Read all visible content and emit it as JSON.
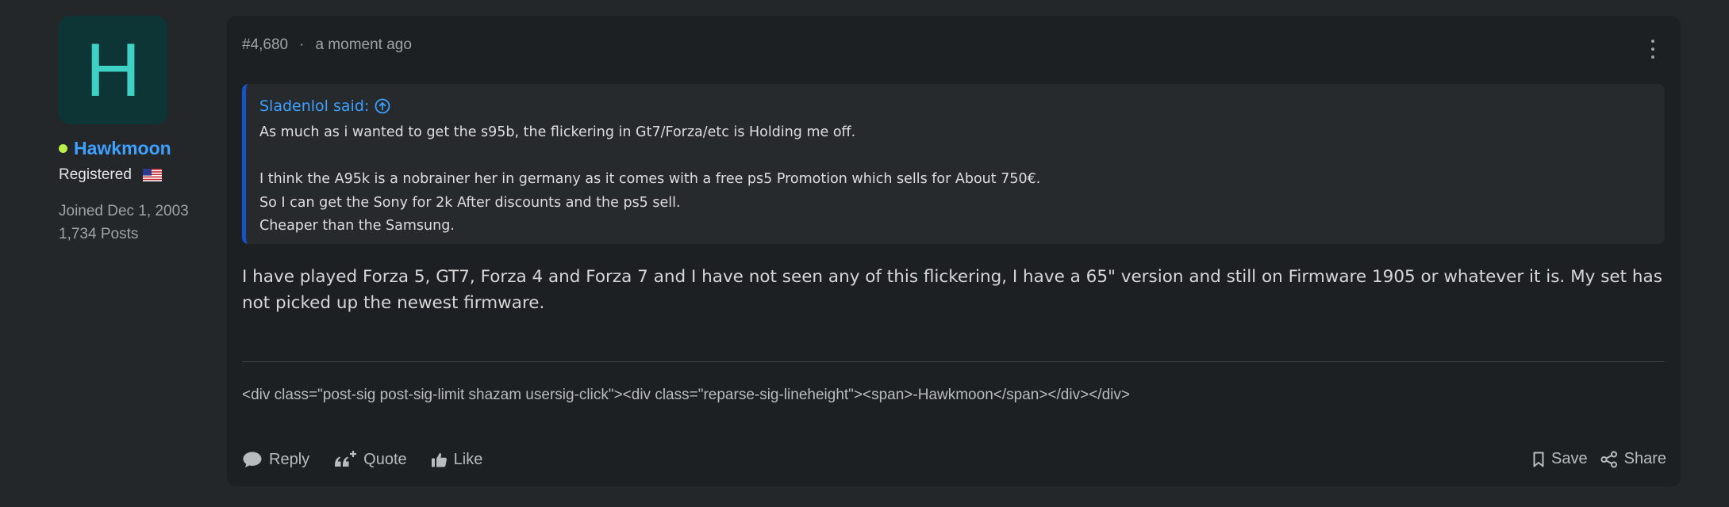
{
  "user": {
    "avatar_letter": "H",
    "username": "Hawkmoon",
    "role": "Registered",
    "joined": "Joined Dec 1, 2003",
    "posts": "1,734 Posts",
    "online_color": "#b9ef4a",
    "avatar_bg": "#0e3535",
    "avatar_fg": "#3fd1c4"
  },
  "post": {
    "number": "#4,680",
    "separator": "·",
    "time": "a moment ago",
    "quote": {
      "author": "Sladenlol said:",
      "lines": [
        "As much as i wanted to get the s95b, the flickering in Gt7/Forza/etc is Holding me off.",
        "",
        "I think the A95k is a nobrainer her in germany as it comes with a free ps5 Promotion which sells for About 750€.",
        "So I can get the Sony for 2k After discounts and the ps5 sell.",
        "Cheaper than the Samsung."
      ]
    },
    "body": "I have played Forza 5, GT7, Forza 4 and Forza 7 and I have not seen any of this flickering, I have a 65\" version and still on Firmware 1905 or whatever it is. My set has not picked up the newest firmware.",
    "signature": "<div class=\"post-sig post-sig-limit shazam usersig-click\"><div class=\"reparse-sig-lineheight\"><span>-Hawkmoon</span></div></div>"
  },
  "actions": {
    "reply": "Reply",
    "quote": "Quote",
    "like": "Like",
    "save": "Save",
    "share": "Share"
  },
  "colors": {
    "accent": "#3ea0ff",
    "quote_bar": "#1553c6",
    "background": "#232729",
    "card": "#1d2022"
  }
}
